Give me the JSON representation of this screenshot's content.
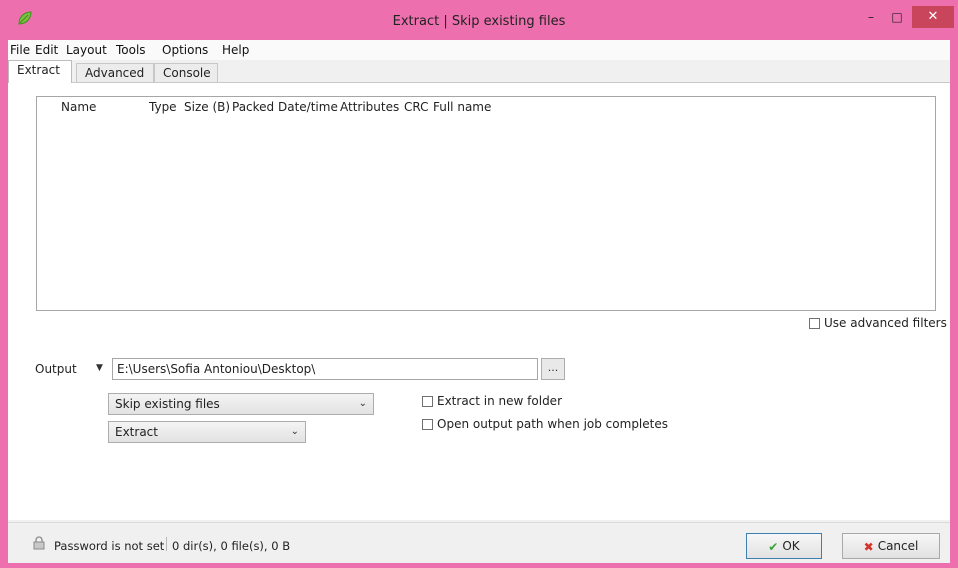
{
  "window": {
    "title": "Extract | Skip existing files",
    "minimize_glyph": "–",
    "maximize_glyph": "□",
    "close_glyph": "✕"
  },
  "menu": [
    "File",
    "Edit",
    "Layout",
    "Tools",
    "Options",
    "Help"
  ],
  "tabs": [
    "Extract",
    "Advanced",
    "Console"
  ],
  "active_tab": "Extract",
  "file_list": {
    "columns": [
      "Name",
      "Type",
      "Size (B)",
      "Packed",
      "Date/time",
      "Attributes",
      "CRC",
      "Full name"
    ],
    "rows": []
  },
  "use_advanced_filters": {
    "label": "Use advanced filters",
    "checked": false
  },
  "output": {
    "label": "Output",
    "path": "E:\\Users\\Sofia Antoniou\\Desktop\\",
    "browse_label": "..."
  },
  "mode_select": {
    "value": "Skip existing files"
  },
  "action_select": {
    "value": "Extract"
  },
  "extract_new_folder": {
    "label": "Extract in new folder",
    "checked": false
  },
  "open_output_path": {
    "label": "Open output path when job completes",
    "checked": false
  },
  "status": {
    "password": "Password is not set",
    "counts": "0 dir(s), 0 file(s), 0 B"
  },
  "buttons": {
    "ok": "OK",
    "cancel": "Cancel"
  },
  "icons": {
    "app": "leaf-app-icon",
    "lock": "lock-icon",
    "ok": "checkmark-icon",
    "cancel": "cross-icon"
  },
  "colors": {
    "frame": "#ee6fae",
    "close_button": "#c9455c",
    "ok_check": "#3aa33a",
    "cancel_cross": "#d4342c"
  }
}
